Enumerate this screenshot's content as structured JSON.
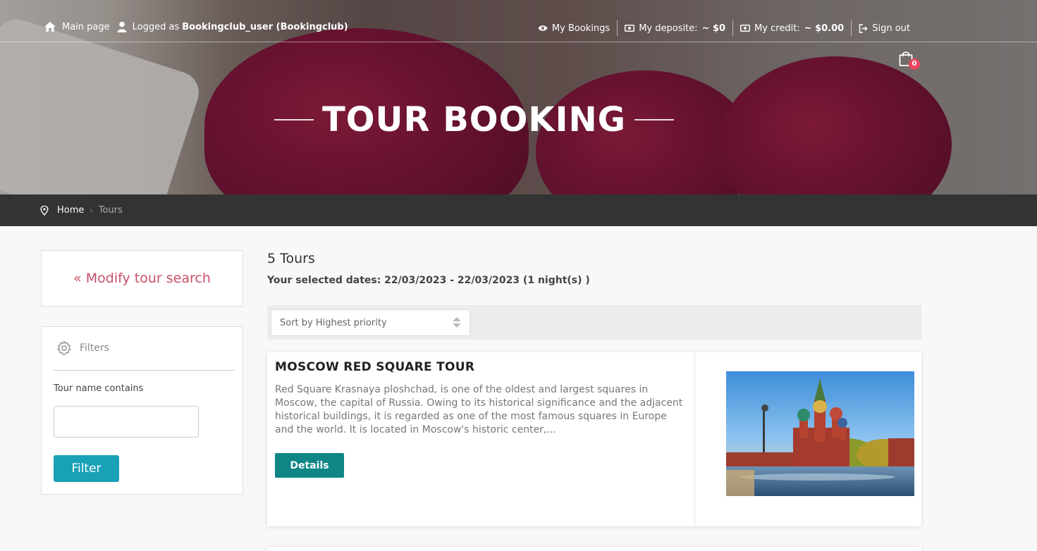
{
  "topbar": {
    "main_page": "Main page",
    "logged_as_prefix": "Logged as",
    "logged_user": "Bookingclub_user (Bookingclub)",
    "my_bookings": "My Bookings",
    "my_deposite_label": "My deposite:",
    "my_deposite_value": "~ $0",
    "my_credit_label": "My credit:",
    "my_credit_value": "~ $0.00",
    "sign_out": "Sign out",
    "cart_count": "0"
  },
  "hero": {
    "title": "TOUR BOOKING"
  },
  "breadcrumb": {
    "home": "Home",
    "separator": "›",
    "current": "Tours"
  },
  "sidebar": {
    "modify_search": "« Modify tour search",
    "filters_title": "Filters",
    "tour_name_label": "Tour name contains",
    "tour_name_value": "",
    "filter_button": "Filter"
  },
  "results": {
    "count": "5 Tours",
    "selected_dates": "Your selected dates: 22/03/2023 - 22/03/2023 (1 night(s) )",
    "sort_selected": "Sort by Highest priority",
    "tours": [
      {
        "title": "MOSCOW RED SQUARE TOUR",
        "description": "Red Square Krasnaya ploshchad, is one of the oldest and largest squares in Moscow, the capital of Russia. Owing to its historical significance and the adjacent historical buildings, it is regarded as one of the most famous squares in Europe and the world. It is located in Moscow's historic center,...",
        "details_label": "Details"
      }
    ]
  },
  "colors": {
    "accent_link": "#c95068",
    "filter_button": "#19a1b7",
    "details_button": "#0f8586",
    "breadcrumb_bar": "#333333",
    "cart_badge": "#e94560"
  }
}
